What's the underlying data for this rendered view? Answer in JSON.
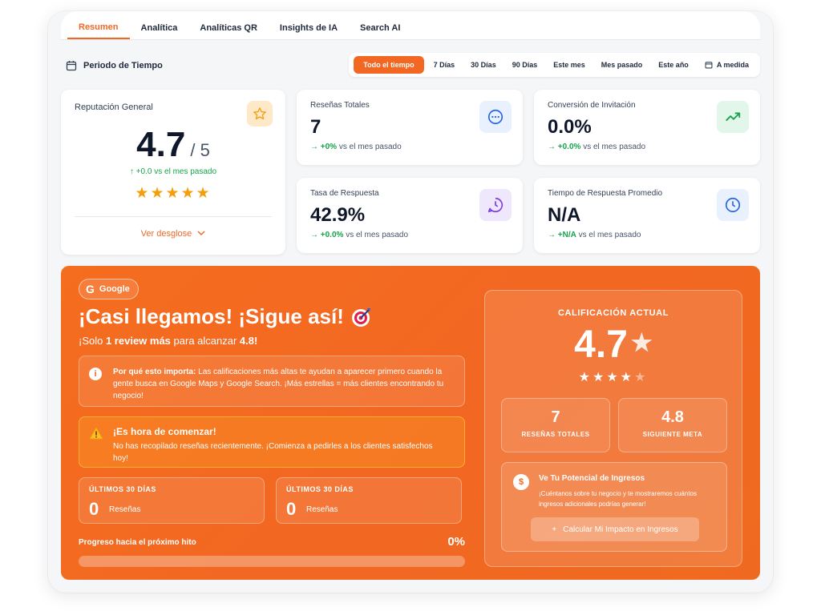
{
  "tabs": [
    {
      "label": "Resumen",
      "active": true
    },
    {
      "label": "Analítica"
    },
    {
      "label": "Analíticas QR"
    },
    {
      "label": "Insights de IA"
    },
    {
      "label": "Search AI"
    }
  ],
  "period": {
    "label": "Periodo de Tiempo",
    "options": [
      "Todo el tiempo",
      "7 Días",
      "30 Días",
      "90 Días",
      "Este mes",
      "Mes pasado",
      "Este año",
      "A medida"
    ],
    "selected": "Todo el tiempo"
  },
  "reputation": {
    "title": "Reputación General",
    "value": "4.7",
    "out_of": "/ 5",
    "change": "↑  +0.0 vs el mes pasado",
    "stars": "★★★★★",
    "link": "Ver desglose"
  },
  "stats": [
    {
      "title": "Reseñas Totales",
      "value": "7",
      "change": "+0%",
      "suffix": "vs el mes pasado",
      "icon": "chat-icon"
    },
    {
      "title": "Conversión de Invitación",
      "value": "0.0%",
      "change": "+0.0%",
      "suffix": "vs el mes pasado",
      "icon": "trending-up-icon"
    },
    {
      "title": "Tasa de Respuesta",
      "value": "42.9%",
      "change": "+0.0%",
      "suffix": "vs el mes pasado",
      "icon": "reply-time-icon"
    },
    {
      "title": "Tiempo de Respuesta Promedio",
      "value": "N/A",
      "change": "+N/A",
      "suffix": "vs el mes pasado",
      "icon": "clock-icon"
    }
  ],
  "banner": {
    "badge": "Google",
    "headline": "¡Casi llegamos! ¡Sigue así!",
    "sub_prefix": "¡Solo ",
    "sub_bold": "1 review más",
    "sub_mid": " para alcanzar ",
    "sub_target": "4.8!",
    "info_bold": "Por qué esto importa:",
    "info_text": " Las calificaciones más altas te ayudan a aparecer primero cuando la gente busca en Google Maps y Google Search. ¡Más estrellas = más clientes encontrando tu negocio!",
    "warn_title": "¡Es hora de comenzar!",
    "warn_text": "No has recopilado reseñas recientemente. ¡Comienza a pedirles a los clientes satisfechos hoy!",
    "mini": [
      {
        "label": "ÚLTIMOS 30 DÍAS",
        "value": "0",
        "unit": "Reseñas"
      },
      {
        "label": "ÚLTIMOS 30 DÍAS",
        "value": "0",
        "unit": "Reseñas"
      }
    ],
    "progress_label": "Progreso hacia el próximo hito",
    "progress_text": "0%",
    "progress_value": 0
  },
  "rating_panel": {
    "label": "CALIFICACIÓN ACTUAL",
    "value": "4.7",
    "star": "★",
    "stars_full": "★★★★",
    "stars_dim": "★",
    "boxes": [
      {
        "value": "7",
        "label": "RESEÑAS TOTALES"
      },
      {
        "value": "4.8",
        "label": "SIGUIENTE META"
      }
    ],
    "potential_title": "Ve Tu Potencial de Ingresos",
    "potential_text": "¡Cuéntanos sobre tu negocio y te mostraremos cuántos ingresos adicionales podrías generar!",
    "potential_button": "Calcular Mi Impacto en Ingresos"
  },
  "colors": {
    "accent": "#f26722",
    "positive": "#16a34a"
  }
}
